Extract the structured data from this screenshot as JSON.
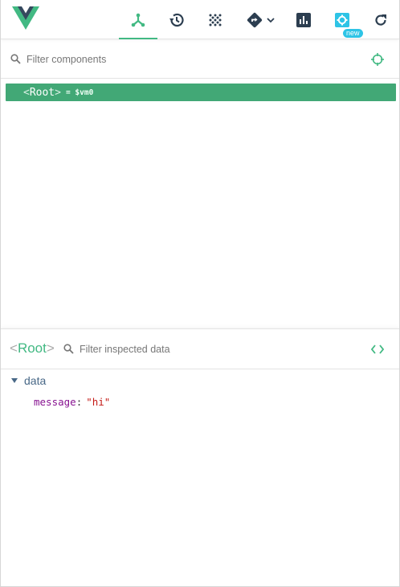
{
  "header": {
    "tabs": [
      {
        "icon": "components-icon",
        "active": true
      },
      {
        "icon": "history-icon",
        "active": false
      },
      {
        "icon": "vuex-icon",
        "active": false
      },
      {
        "icon": "events-icon",
        "active": false
      },
      {
        "icon": "performance-icon",
        "active": false
      },
      {
        "icon": "settings-icon",
        "active": false
      },
      {
        "icon": "refresh-icon",
        "active": false
      }
    ],
    "settings_badge": "new",
    "accent_color": "#42b983",
    "badge_color": "#2ec4e6"
  },
  "components_filter": {
    "placeholder": "Filter components"
  },
  "tree": {
    "rows": [
      {
        "open_bracket": "<",
        "name": "Root",
        "close_bracket": ">",
        "ref": "= $vm0",
        "selected": true
      }
    ],
    "selected_color": "#42a876"
  },
  "inspector": {
    "open_bracket": "<",
    "name": "Root",
    "close_bracket": ">",
    "filter_placeholder": "Filter inspected data",
    "section_label": "data",
    "fields": [
      {
        "key": "message",
        "colon": ":",
        "value": "\"hi\""
      }
    ]
  }
}
